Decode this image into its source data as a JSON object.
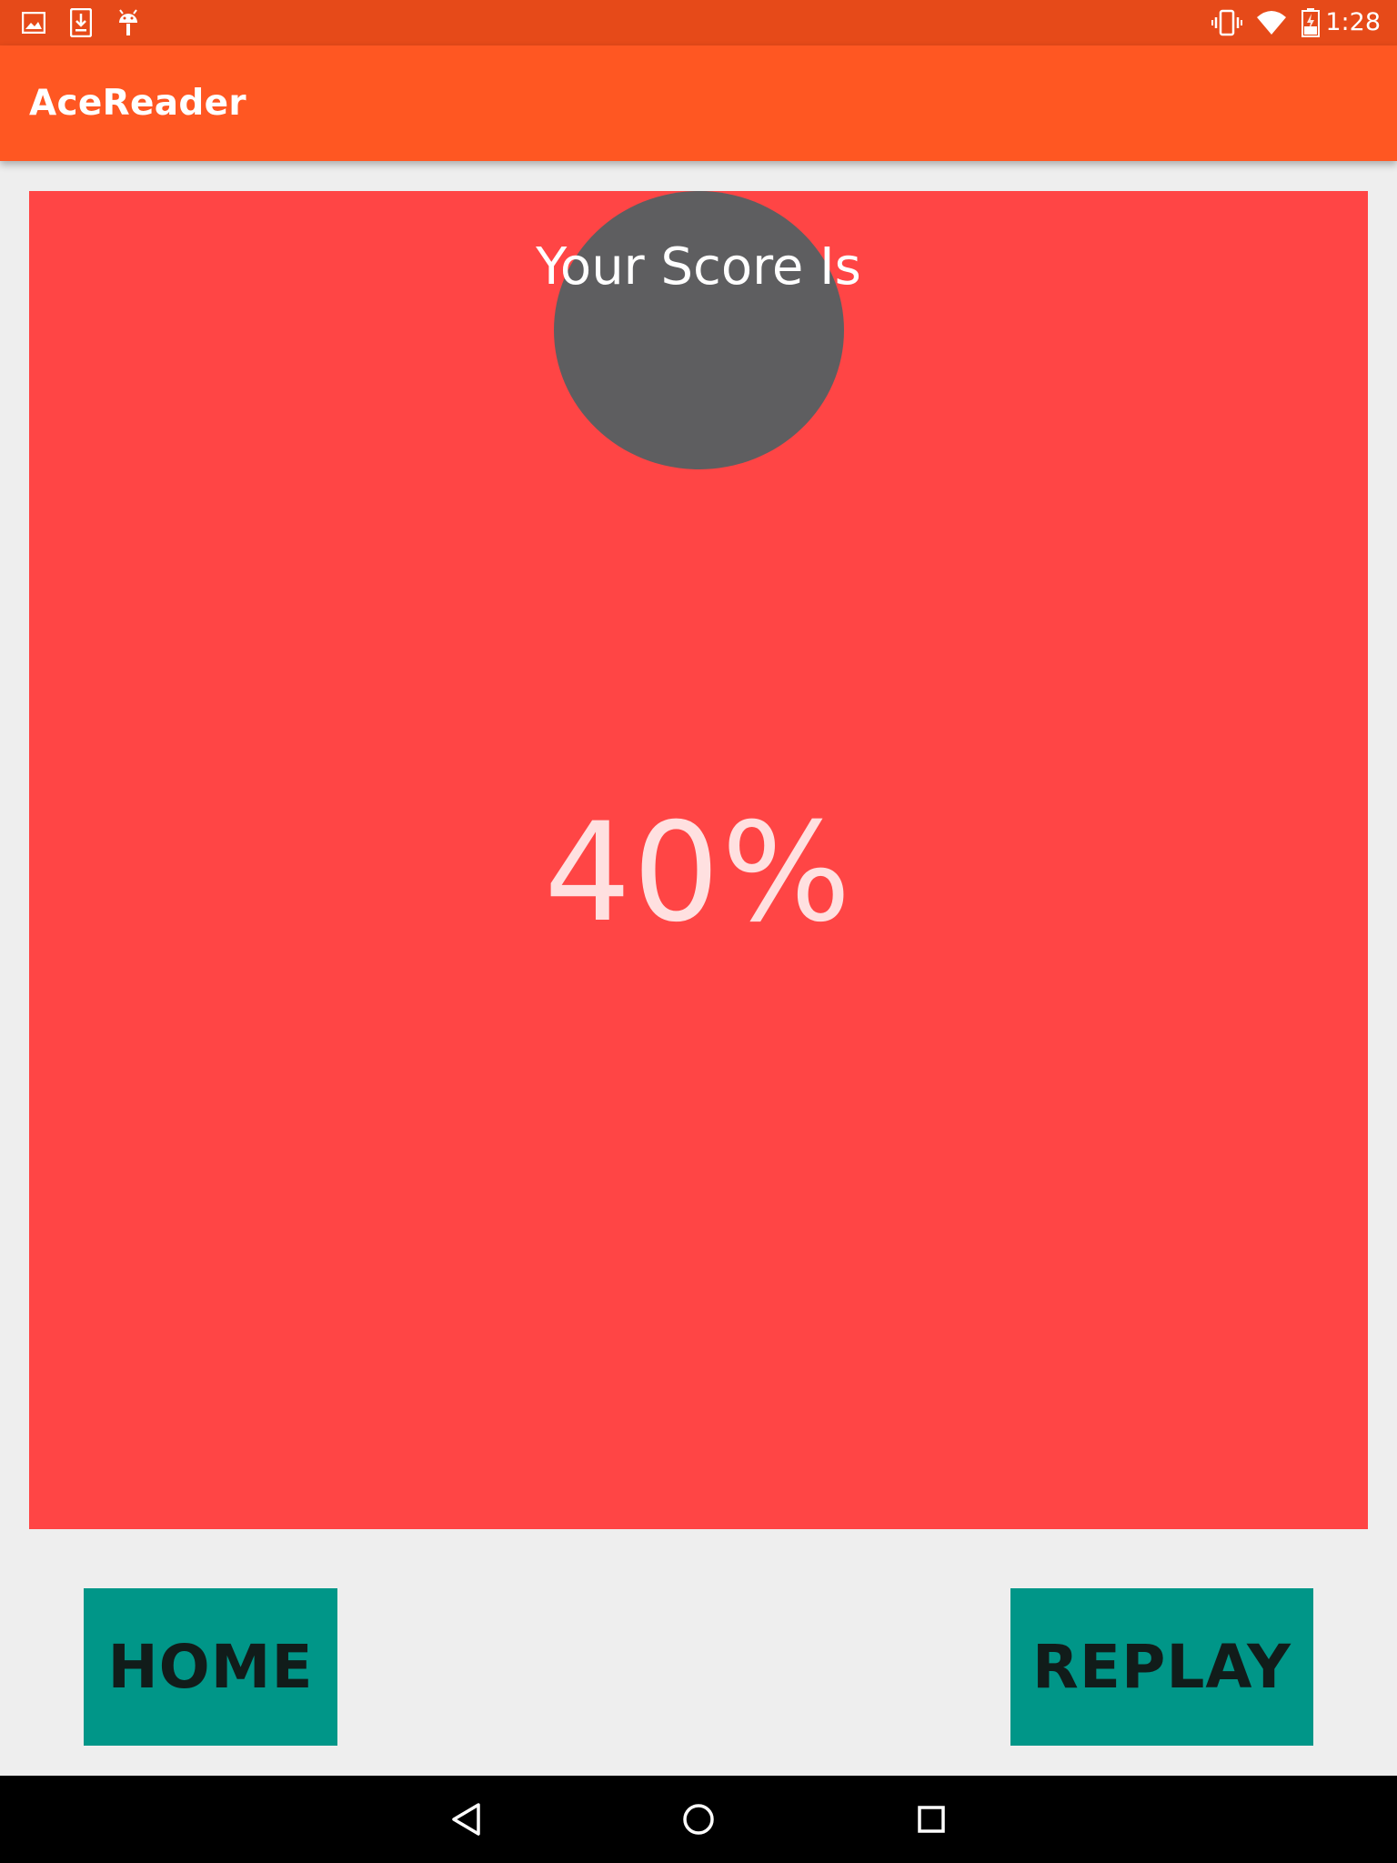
{
  "status_bar": {
    "time": "1:28",
    "left_icons": [
      "image-icon",
      "download-icon",
      "android-debug-icon"
    ],
    "right_icons": [
      "vibrate-icon",
      "wifi-icon",
      "battery-icon"
    ]
  },
  "app_bar": {
    "title": "AceReader"
  },
  "score_card": {
    "heading": "Your Score Is",
    "value": "40%",
    "score_percent": 40
  },
  "buttons": {
    "home_label": "HOME",
    "replay_label": "REPLAY"
  },
  "nav_bar": {
    "icons": [
      "back-icon",
      "home-icon",
      "recents-icon"
    ]
  },
  "colors": {
    "status_bar": "#e64a19",
    "app_bar": "#ff5722",
    "card": "#ff4545",
    "circle": "#5e5e60",
    "button": "#009688"
  }
}
